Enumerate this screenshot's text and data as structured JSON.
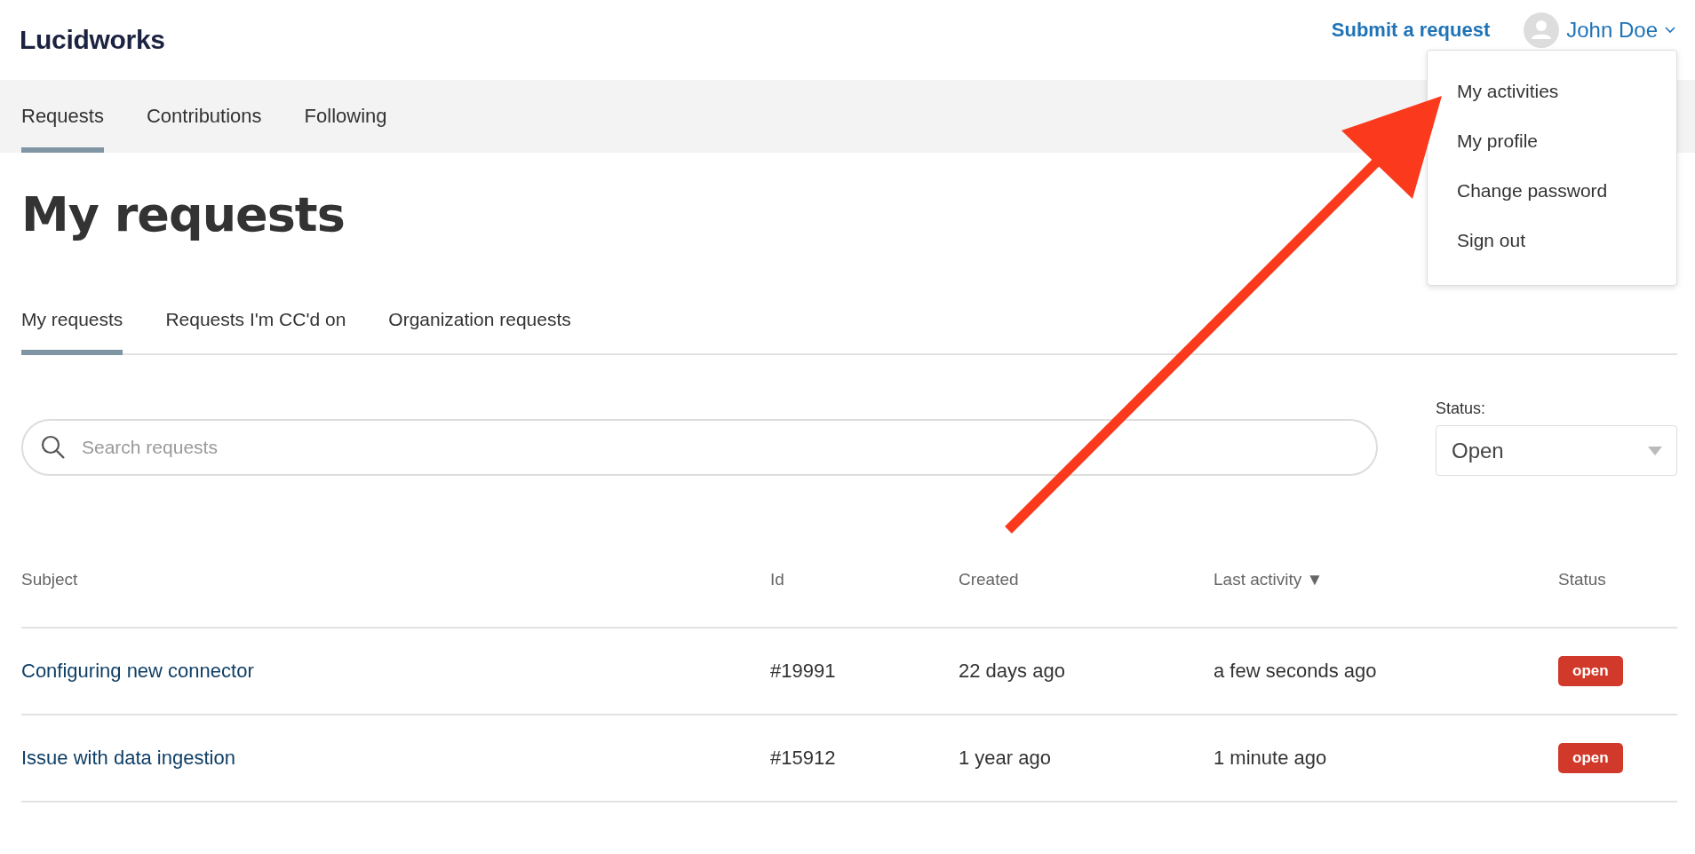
{
  "header": {
    "logo": "Lucidworks",
    "submit_link": "Submit a request",
    "user_name": "John Doe"
  },
  "user_menu": {
    "expanded": true,
    "items": [
      {
        "label": "My activities"
      },
      {
        "label": "My profile"
      },
      {
        "label": "Change password"
      },
      {
        "label": "Sign out"
      }
    ]
  },
  "nav_tabs": [
    {
      "label": "Requests",
      "selected": true
    },
    {
      "label": "Contributions",
      "selected": false
    },
    {
      "label": "Following",
      "selected": false
    }
  ],
  "title": "My requests",
  "sub_tabs": [
    {
      "label": "My requests",
      "selected": true
    },
    {
      "label": "Requests I'm CC'd on",
      "selected": false
    },
    {
      "label": "Organization requests",
      "selected": false
    }
  ],
  "search": {
    "placeholder": "Search requests"
  },
  "status_filter": {
    "label": "Status:",
    "value": "Open"
  },
  "table": {
    "columns": [
      {
        "label": "Subject"
      },
      {
        "label": "Id"
      },
      {
        "label": "Created"
      },
      {
        "label": "Last activity",
        "sort_indicator": "▼"
      },
      {
        "label": "Status"
      }
    ],
    "rows": [
      {
        "subject": "Configuring new connector",
        "id": "#19991",
        "created": "22 days ago",
        "last_activity": "a few seconds ago",
        "status": "open"
      },
      {
        "subject": "Issue with data ingestion",
        "id": "#15912",
        "created": "1 year ago",
        "last_activity": "1 minute ago",
        "status": "open"
      }
    ]
  }
}
